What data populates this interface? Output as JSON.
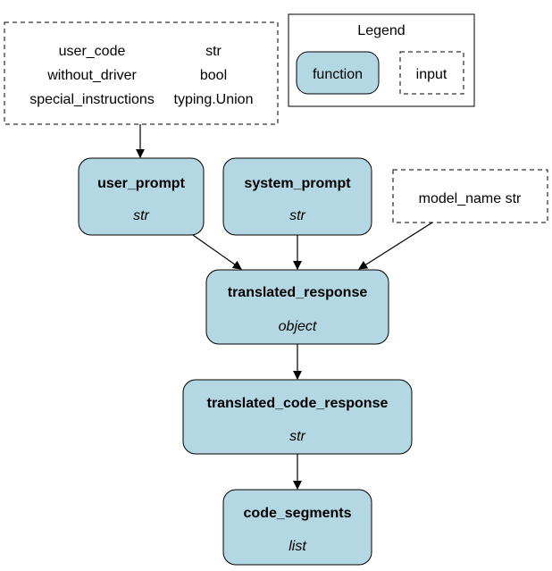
{
  "legend": {
    "title": "Legend",
    "function_label": "function",
    "input_label": "input"
  },
  "inputs_block": {
    "rows": [
      {
        "name": "user_code",
        "type": "str"
      },
      {
        "name": "without_driver",
        "type": "bool"
      },
      {
        "name": "special_instructions",
        "type": "typing.Union"
      }
    ]
  },
  "model_name_input": {
    "label": "model_name str"
  },
  "nodes": {
    "user_prompt": {
      "name": "user_prompt",
      "type": "str"
    },
    "system_prompt": {
      "name": "system_prompt",
      "type": "str"
    },
    "translated_response": {
      "name": "translated_response",
      "type": "object"
    },
    "translated_code_response": {
      "name": "translated_code_response",
      "type": "str"
    },
    "code_segments": {
      "name": "code_segments",
      "type": "list"
    }
  },
  "colors": {
    "function_fill": "#b3d7e3"
  }
}
